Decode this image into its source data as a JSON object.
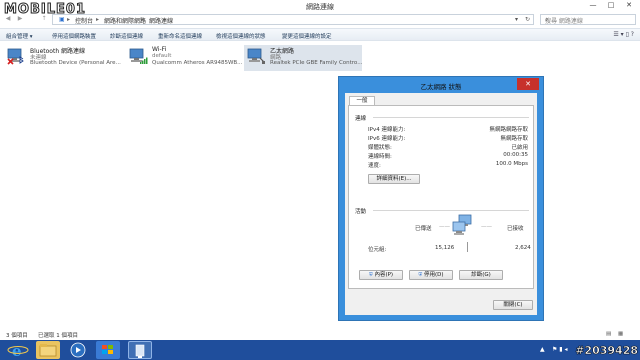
{
  "window": {
    "title": "網路連線",
    "watermark": "MOBILE01",
    "minimize": "—",
    "maximize": "□",
    "close": "✕"
  },
  "address": {
    "back": "◀",
    "forward": "▶",
    "up": "↑",
    "path": [
      "控制台",
      "網路和網際網路",
      "網路連線"
    ],
    "separator": "▸",
    "refresh": "↻",
    "dropdown": "▾",
    "search_placeholder": "搜尋 網路連線",
    "search_icon": "⌕"
  },
  "toolbar": {
    "organize": "組合管理 ▾",
    "items": [
      "停用這個網路裝置",
      "診斷這個連線",
      "重新命名這個連線",
      "檢視這個連線的狀態",
      "變更這個連線的設定"
    ],
    "icons": "☰ ▾  ▯  ?"
  },
  "adapters": [
    {
      "name": "Bluetooth 網路連線",
      "status": "未連線",
      "device": "Bluetooth Device (Personal Are...",
      "icon": "bluetooth-adapter-icon"
    },
    {
      "name": "Wi-Fi",
      "status": "default",
      "device": "Qualcomm Atheros AR9485WB...",
      "icon": "wifi-adapter-icon"
    },
    {
      "name": "乙太網路",
      "status": "網路",
      "device": "Realtek PCIe GBE Family Contro...",
      "icon": "ethernet-adapter-icon"
    }
  ],
  "statusbar": {
    "count": "3 個項目",
    "selected": "已選取 1 個項目"
  },
  "dialog": {
    "title": "乙太網路 狀態",
    "close": "✕",
    "tab": "一般",
    "connection": {
      "heading": "連線",
      "rows": [
        {
          "label": "IPv4 連線能力:",
          "value": "無網路網路存取"
        },
        {
          "label": "IPv6 連線能力:",
          "value": "無網路存取"
        },
        {
          "label": "媒體狀態:",
          "value": "已啟用"
        },
        {
          "label": "連線時間:",
          "value": "00:00:35"
        },
        {
          "label": "速度:",
          "value": "100.0 Mbps"
        }
      ],
      "details_button": "詳細資料(E)..."
    },
    "activity": {
      "heading": "活動",
      "sent_label": "已傳送",
      "received_label": "已接收",
      "bytes_label": "位元組:",
      "bytes_sent": "15,126",
      "bytes_received": "2,624"
    },
    "buttons": {
      "properties": "內容(P)",
      "disable": "停用(D)",
      "diagnose": "診斷(G)",
      "close": "關閉(C)"
    }
  },
  "taskbar": {
    "tray_flag": "▲",
    "tray_icons": "⚑ ▮ ◂",
    "watermark": "#2039428"
  },
  "colors": {
    "dialog_frame": "#3a8fdc",
    "taskbar": "#1f4e9c",
    "close_button": "#c7312b",
    "accent_link": "#1e3958"
  }
}
